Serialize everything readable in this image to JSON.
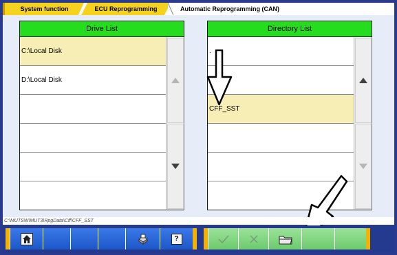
{
  "breadcrumb": {
    "tabs": [
      "System function",
      "ECU Reprogramming",
      "Automatic Reprogramming (CAN)"
    ]
  },
  "drive_list": {
    "header": "Drive List",
    "items": [
      "C:\\Local Disk",
      "D:\\Local Disk",
      "",
      "",
      "",
      ""
    ],
    "selected_index": 0
  },
  "directory_list": {
    "header": "Directory List",
    "items": [
      ".",
      "..",
      "CFF_SST",
      "",
      "",
      ""
    ],
    "selected_index": 2
  },
  "status": {
    "path": "C:\\MUTSW\\MUT3\\RpgData\\Cff\\CFF_SST"
  },
  "colors": {
    "frame": "#2a3a8e",
    "list_header": "#26dc1e",
    "selected_row": "#f6eeb5",
    "tab_active": "#f5d21e",
    "toolbar_blue": "#1d57c9",
    "toolbar_green": "#6ccb6c",
    "toolbar_endcap": "#f3b100"
  },
  "toolbar": {
    "left_icons": [
      "home-icon",
      "",
      "",
      "",
      "print-icon",
      "help-icon"
    ],
    "right_icons": [
      "check-icon",
      "close-icon",
      "folder-icon",
      "",
      ""
    ]
  }
}
